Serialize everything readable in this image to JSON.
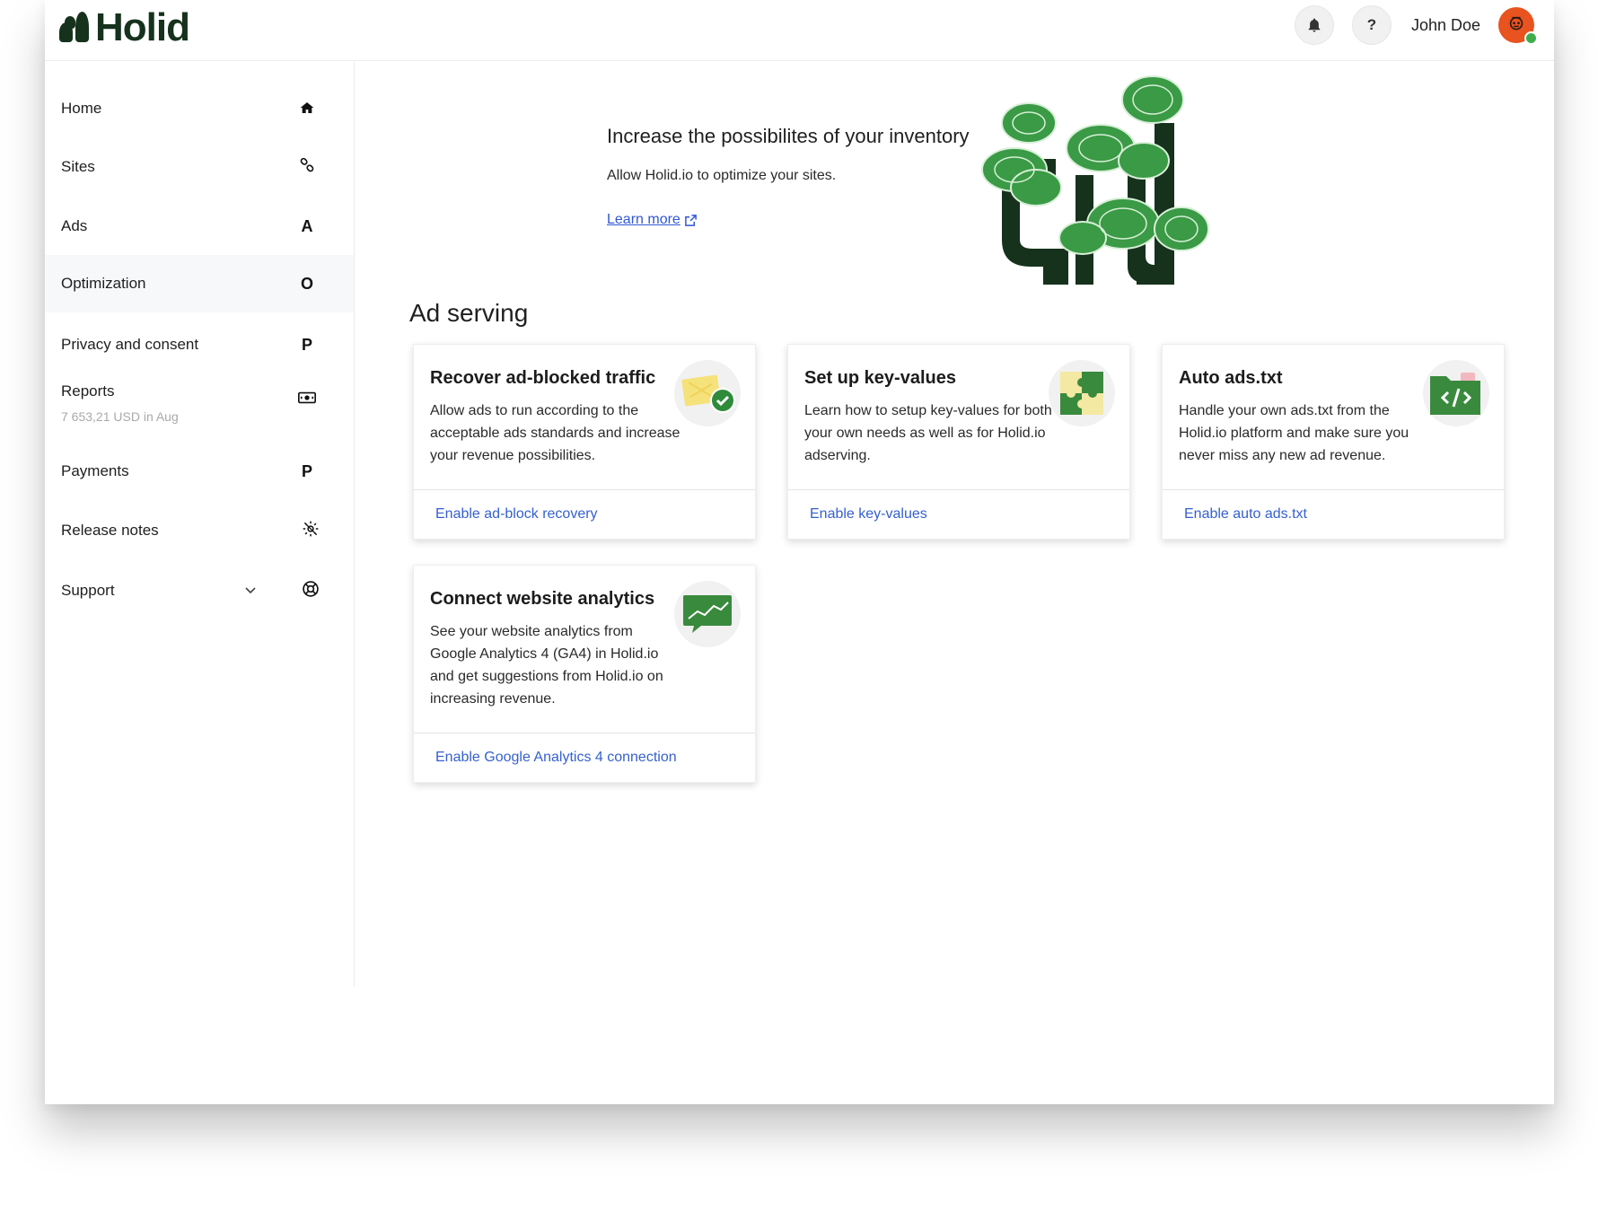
{
  "brand": {
    "name": "Holid",
    "color": "#16321c"
  },
  "topbar": {
    "notifications_icon": "bell-icon",
    "help_label": "?",
    "user_name": "John Doe",
    "avatar_color": "#e8531f",
    "online_color": "#3cae4b"
  },
  "sidebar": {
    "items": [
      {
        "label": "Home",
        "icon": "home-icon"
      },
      {
        "label": "Sites",
        "icon": "link-icon"
      },
      {
        "label": "Ads",
        "icon_letter": "A"
      },
      {
        "label": "Optimization",
        "icon_letter": "O",
        "active": true
      },
      {
        "label": "Privacy and consent",
        "icon_letter": "P"
      },
      {
        "label": "Reports",
        "sub": "7 653,21 USD in Aug",
        "icon": "money-icon"
      },
      {
        "label": "Payments",
        "icon_letter": "P"
      },
      {
        "label": "Release notes",
        "icon": "gear-icon"
      },
      {
        "label": "Support",
        "icon": "lifebuoy-icon",
        "chevron": "chevron-down-icon"
      }
    ]
  },
  "hero": {
    "title": "Increase the possibilites of your inventory",
    "subtitle": "Allow Holid.io to optimize your sites.",
    "link": "Learn more"
  },
  "section": {
    "title": "Ad serving"
  },
  "cards": [
    {
      "title": "Recover ad-blocked traffic",
      "description": "Allow ads to run according to the acceptable ads standards and increase your revenue possibilities.",
      "action": "Enable ad-block recovery",
      "icon": "ad-block-check-icon"
    },
    {
      "title": "Set up key-values",
      "description": "Learn how to setup key-values for both your own needs as well as for Holid.io adserving.",
      "action": "Enable key-values",
      "icon": "puzzle-icon"
    },
    {
      "title": "Auto ads.txt",
      "description": "Handle your own ads.txt from the Holid.io platform and make sure you never miss any new ad revenue.",
      "action": "Enable auto ads.txt",
      "icon": "code-folder-icon"
    },
    {
      "title": "Connect website analytics",
      "description": "See your website analytics from Google Analytics 4 (GA4) in Holid.io and get suggestions from Holid.io on increasing revenue.",
      "action": "Enable Google Analytics 4 connection",
      "icon": "analytics-chart-icon"
    }
  ],
  "colors": {
    "accent_link": "#3560cf",
    "icon_green": "#3a8a3e",
    "tree_dark": "#16321c"
  }
}
